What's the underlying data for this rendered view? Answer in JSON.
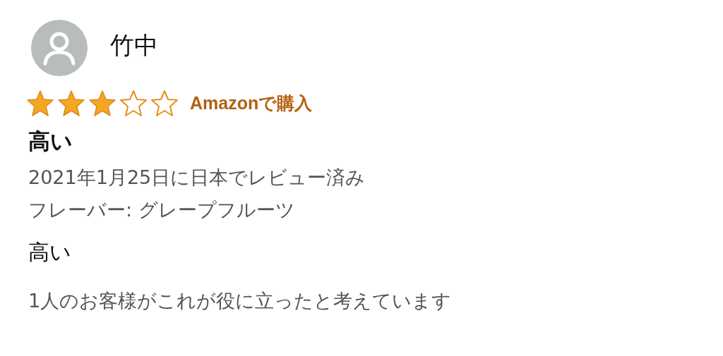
{
  "review": {
    "reviewer": "竹中",
    "stars": 3,
    "badge": "Amazonで購入",
    "title": "高い",
    "date": "2021年1月25日に日本でレビュー済み",
    "variant": "フレーバー: グレープフルーツ",
    "body": "高い",
    "helpful": "1人のお客様がこれが役に立ったと考えています"
  }
}
